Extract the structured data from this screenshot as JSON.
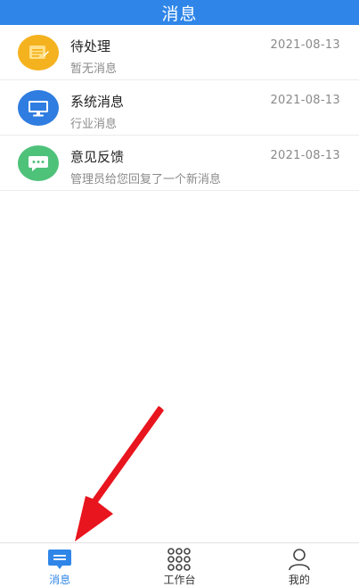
{
  "header": {
    "title": "消息"
  },
  "messages": [
    {
      "title": "待处理",
      "subtitle": "暂无消息",
      "time": "2021-08-13",
      "icon": "document-icon",
      "color": "#f5b21f"
    },
    {
      "title": "系统消息",
      "subtitle": "行业消息",
      "time": "2021-08-13",
      "icon": "monitor-icon",
      "color": "#2f7de0"
    },
    {
      "title": "意见反馈",
      "subtitle": "管理员给您回复了一个新消息",
      "time": "2021-08-13",
      "icon": "chat-bubble-icon",
      "color": "#4fc27a"
    }
  ],
  "tabbar": {
    "active": "消息",
    "active_color": "#2f86e8",
    "items": [
      {
        "label": "消息",
        "icon": "message-icon"
      },
      {
        "label": "工作台",
        "icon": "grid-icon"
      },
      {
        "label": "我的",
        "icon": "user-icon"
      }
    ]
  },
  "annotation": {
    "arrow_color": "#e8141e"
  }
}
